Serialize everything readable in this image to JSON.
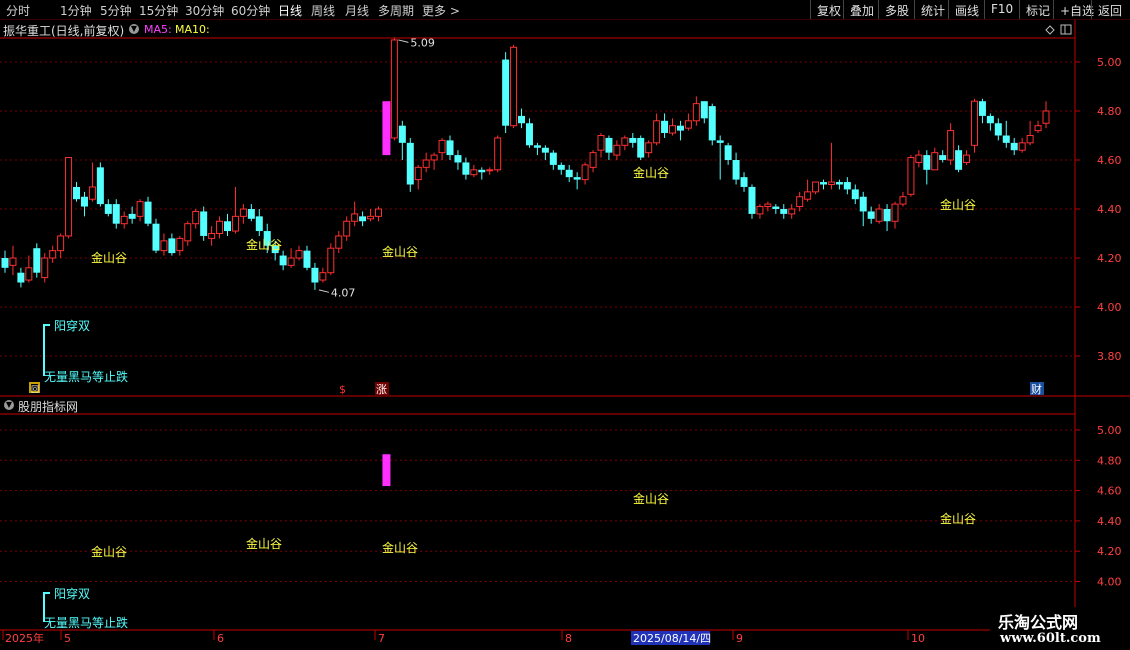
{
  "toolbar": {
    "periods": [
      "分时",
      "1分钟",
      "5分钟",
      "15分钟",
      "30分钟",
      "60分钟",
      "日线",
      "周线",
      "月线",
      "多周期",
      "更多"
    ],
    "active_period": "日线",
    "buttons": [
      "复权",
      "叠加",
      "多股",
      "统计",
      "画线",
      "F10",
      "标记",
      "+自选",
      "返回"
    ]
  },
  "chart_header": {
    "stock": "振华重工(日线,前复权)",
    "ma5_label": "MA5:",
    "ma10_label": "MA10:"
  },
  "indicator_header": {
    "title": "股朋指标网"
  },
  "main_axis_labels": [
    "5.00",
    "4.80",
    "4.60",
    "4.40",
    "4.20",
    "4.00",
    "3.80"
  ],
  "sub_axis_labels": [
    "5.00",
    "4.80",
    "4.60",
    "4.40",
    "4.20",
    "4.00"
  ],
  "x_axis": {
    "labels": [
      "2025年",
      "5",
      "6",
      "7",
      "8",
      "9",
      "10"
    ],
    "cursor_date": "2025/08/14/四"
  },
  "annotations": {
    "high": "5.09",
    "low": "4.07",
    "jinshangu": "金山谷",
    "legend_line1": "阳穿双",
    "legend_line2": "无量黑马等止跌",
    "marker_box": "回",
    "marker_s": "$",
    "marker_zhang": "涨",
    "marker_cai": "财"
  },
  "colors": {
    "up": "#ff3030",
    "down": "#54ffff",
    "magenta": "#ff30ff",
    "yellow": "#ffff40",
    "grid": "#7a0000",
    "axis": "#c00000",
    "axis_text": "#ff4040"
  },
  "watermark": {
    "line1": "乐淘公式网",
    "line2": "www.60lt.com"
  },
  "chart_data": {
    "type": "candlestick",
    "title": "振华重工(日线,前复权)",
    "y_range": [
      3.66,
      5.13
    ],
    "candles": [
      [
        4.2,
        4.16,
        4.23,
        4.14
      ],
      [
        4.17,
        4.2,
        4.25,
        4.13
      ],
      [
        4.14,
        4.1,
        4.16,
        4.08
      ],
      [
        4.11,
        4.16,
        4.21,
        4.1
      ],
      [
        4.24,
        4.14,
        4.26,
        4.12
      ],
      [
        4.12,
        4.2,
        4.22,
        4.1
      ],
      [
        4.2,
        4.23,
        4.25,
        4.18
      ],
      [
        4.23,
        4.29,
        4.3,
        4.2
      ],
      [
        4.29,
        4.61,
        4.61,
        4.28
      ],
      [
        4.49,
        4.44,
        4.51,
        4.43
      ],
      [
        4.45,
        4.41,
        4.47,
        4.37
      ],
      [
        4.44,
        4.49,
        4.59,
        4.43
      ],
      [
        4.57,
        4.42,
        4.59,
        4.41
      ],
      [
        4.42,
        4.38,
        4.44,
        4.37
      ],
      [
        4.42,
        4.34,
        4.44,
        4.32
      ],
      [
        4.34,
        4.37,
        4.39,
        4.32
      ],
      [
        4.38,
        4.36,
        4.41,
        4.34
      ],
      [
        4.37,
        4.43,
        4.44,
        4.35
      ],
      [
        4.43,
        4.34,
        4.45,
        4.33
      ],
      [
        4.34,
        4.23,
        4.36,
        4.22
      ],
      [
        4.23,
        4.27,
        4.3,
        4.21
      ],
      [
        4.28,
        4.22,
        4.3,
        4.21
      ],
      [
        4.23,
        4.28,
        4.29,
        4.21
      ],
      [
        4.27,
        4.34,
        4.35,
        4.25
      ],
      [
        4.34,
        4.39,
        4.4,
        4.32
      ],
      [
        4.39,
        4.29,
        4.41,
        4.27
      ],
      [
        4.28,
        4.3,
        4.33,
        4.25
      ],
      [
        4.3,
        4.35,
        4.37,
        4.28
      ],
      [
        4.35,
        4.31,
        4.38,
        4.29
      ],
      [
        4.31,
        4.37,
        4.49,
        4.3
      ],
      [
        4.37,
        4.4,
        4.42,
        4.34
      ],
      [
        4.4,
        4.36,
        4.42,
        4.35
      ],
      [
        4.37,
        4.31,
        4.4,
        4.29
      ],
      [
        4.31,
        4.25,
        4.34,
        4.22
      ],
      [
        4.25,
        4.22,
        4.27,
        4.19
      ],
      [
        4.21,
        4.17,
        4.23,
        4.15
      ],
      [
        4.17,
        4.2,
        4.24,
        4.16
      ],
      [
        4.2,
        4.23,
        4.25,
        4.19
      ],
      [
        4.23,
        4.16,
        4.25,
        4.15
      ],
      [
        4.16,
        4.1,
        4.18,
        4.07
      ],
      [
        4.11,
        4.14,
        4.16,
        4.1
      ],
      [
        4.14,
        4.24,
        4.26,
        4.13
      ],
      [
        4.24,
        4.29,
        4.31,
        4.22
      ],
      [
        4.29,
        4.35,
        4.37,
        4.27
      ],
      [
        4.35,
        4.38,
        4.43,
        4.33
      ],
      [
        4.37,
        4.35,
        4.39,
        4.33
      ],
      [
        4.36,
        4.37,
        4.4,
        4.35
      ],
      [
        4.37,
        4.4,
        4.41,
        4.35
      ],
      [
        4.69,
        4.69,
        4.69,
        4.62
      ],
      [
        4.69,
        5.09,
        5.1,
        4.68
      ],
      [
        4.74,
        4.67,
        4.76,
        4.6
      ],
      [
        4.67,
        4.5,
        4.69,
        4.47
      ],
      [
        4.52,
        4.57,
        4.58,
        4.48
      ],
      [
        4.57,
        4.6,
        4.63,
        4.55
      ],
      [
        4.6,
        4.62,
        4.63,
        4.56
      ],
      [
        4.63,
        4.68,
        4.69,
        4.6
      ],
      [
        4.68,
        4.62,
        4.7,
        4.6
      ],
      [
        4.62,
        4.59,
        4.64,
        4.56
      ],
      [
        4.59,
        4.54,
        4.61,
        4.52
      ],
      [
        4.54,
        4.56,
        4.58,
        4.53
      ],
      [
        4.56,
        4.55,
        4.57,
        4.52
      ],
      [
        4.56,
        4.56,
        4.57,
        4.54
      ],
      [
        4.56,
        4.69,
        4.7,
        4.55
      ],
      [
        5.01,
        4.74,
        5.04,
        4.71
      ],
      [
        4.74,
        5.06,
        5.07,
        4.73
      ],
      [
        4.78,
        4.75,
        4.81,
        4.73
      ],
      [
        4.75,
        4.66,
        4.77,
        4.65
      ],
      [
        4.66,
        4.65,
        4.67,
        4.62
      ],
      [
        4.65,
        4.63,
        4.66,
        4.6
      ],
      [
        4.63,
        4.58,
        4.64,
        4.56
      ],
      [
        4.58,
        4.56,
        4.59,
        4.54
      ],
      [
        4.56,
        4.53,
        4.58,
        4.51
      ],
      [
        4.53,
        4.52,
        4.55,
        4.48
      ],
      [
        4.52,
        4.58,
        4.59,
        4.5
      ],
      [
        4.57,
        4.63,
        4.64,
        4.55
      ],
      [
        4.64,
        4.7,
        4.71,
        4.61
      ],
      [
        4.69,
        4.63,
        4.7,
        4.6
      ],
      [
        4.62,
        4.66,
        4.68,
        4.6
      ],
      [
        4.66,
        4.69,
        4.7,
        4.64
      ],
      [
        4.69,
        4.67,
        4.71,
        4.65
      ],
      [
        4.69,
        4.61,
        4.7,
        4.6
      ],
      [
        4.63,
        4.67,
        4.68,
        4.61
      ],
      [
        4.67,
        4.76,
        4.79,
        4.66
      ],
      [
        4.76,
        4.71,
        4.79,
        4.69
      ],
      [
        4.71,
        4.74,
        4.77,
        4.7
      ],
      [
        4.74,
        4.72,
        4.76,
        4.68
      ],
      [
        4.73,
        4.76,
        4.79,
        4.72
      ],
      [
        4.76,
        4.83,
        4.86,
        4.74
      ],
      [
        4.84,
        4.77,
        4.84,
        4.75
      ],
      [
        4.82,
        4.68,
        4.83,
        4.66
      ],
      [
        4.68,
        4.67,
        4.7,
        4.52
      ],
      [
        4.66,
        4.6,
        4.67,
        4.58
      ],
      [
        4.6,
        4.52,
        4.63,
        4.5
      ],
      [
        4.53,
        4.49,
        4.55,
        4.47
      ],
      [
        4.49,
        4.38,
        4.5,
        4.36
      ],
      [
        4.38,
        4.41,
        4.42,
        4.36
      ],
      [
        4.41,
        4.42,
        4.43,
        4.39
      ],
      [
        4.41,
        4.4,
        4.42,
        4.38
      ],
      [
        4.4,
        4.38,
        4.42,
        4.36
      ],
      [
        4.38,
        4.4,
        4.42,
        4.36
      ],
      [
        4.41,
        4.45,
        4.47,
        4.39
      ],
      [
        4.44,
        4.47,
        4.52,
        4.43
      ],
      [
        4.47,
        4.51,
        4.51,
        4.46
      ],
      [
        4.51,
        4.5,
        4.52,
        4.48
      ],
      [
        4.5,
        4.51,
        4.67,
        4.48
      ],
      [
        4.51,
        4.5,
        4.52,
        4.48
      ],
      [
        4.51,
        4.48,
        4.53,
        4.46
      ],
      [
        4.48,
        4.44,
        4.5,
        4.42
      ],
      [
        4.45,
        4.39,
        4.47,
        4.33
      ],
      [
        4.39,
        4.36,
        4.41,
        4.34
      ],
      [
        4.35,
        4.4,
        4.42,
        4.34
      ],
      [
        4.4,
        4.35,
        4.42,
        4.31
      ],
      [
        4.35,
        4.42,
        4.43,
        4.32
      ],
      [
        4.42,
        4.45,
        4.47,
        4.41
      ],
      [
        4.46,
        4.61,
        4.62,
        4.45
      ],
      [
        4.59,
        4.62,
        4.64,
        4.57
      ],
      [
        4.62,
        4.56,
        4.64,
        4.5
      ],
      [
        4.56,
        4.63,
        4.65,
        4.56
      ],
      [
        4.62,
        4.6,
        4.64,
        4.59
      ],
      [
        4.6,
        4.72,
        4.75,
        4.58
      ],
      [
        4.64,
        4.56,
        4.66,
        4.55
      ],
      [
        4.59,
        4.62,
        4.64,
        4.58
      ],
      [
        4.66,
        4.84,
        4.85,
        4.63
      ],
      [
        4.84,
        4.78,
        4.85,
        4.75
      ],
      [
        4.78,
        4.75,
        4.79,
        4.72
      ],
      [
        4.75,
        4.7,
        4.77,
        4.68
      ],
      [
        4.7,
        4.67,
        4.76,
        4.65
      ],
      [
        4.67,
        4.64,
        4.69,
        4.62
      ],
      [
        4.64,
        4.67,
        4.69,
        4.63
      ],
      [
        4.67,
        4.7,
        4.76,
        4.66
      ],
      [
        4.72,
        4.74,
        4.76,
        4.71
      ],
      [
        4.75,
        4.8,
        4.84,
        4.73
      ]
    ]
  }
}
